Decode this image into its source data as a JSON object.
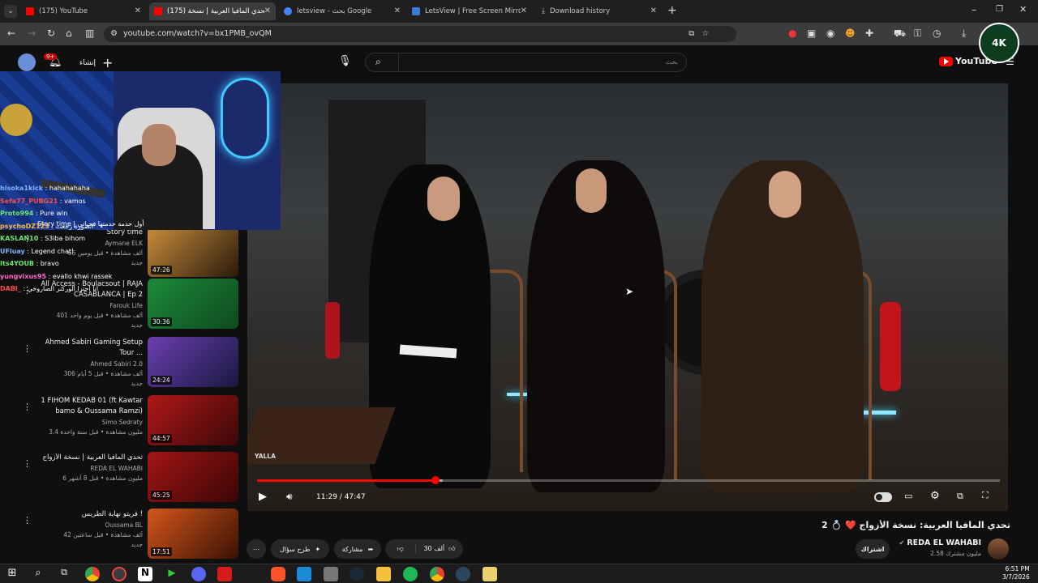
{
  "tabs": [
    {
      "title": "(175) YouTube",
      "fav_color": "#ff0000"
    },
    {
      "title": "تحدي المافيا العربية | نسخة (175)",
      "fav_color": "#ff0000"
    },
    {
      "title": "letsview - بحث Google",
      "fav_color": "#4285f4"
    },
    {
      "title": "LetsView | Free Screen Mirrorin",
      "fav_color": "#3a7bd5"
    },
    {
      "title": "Download history",
      "fav_color": "#9aa0a6"
    }
  ],
  "url": "youtube.com/watch?v=bx1PMB_ovQM",
  "youtube": {
    "create_label": "إنشاء",
    "notif_count": "9+",
    "search_placeholder": "بحث",
    "logo_text": "YouTube",
    "channel_badge": "4K"
  },
  "overlay_label": "Story time | أول حدمة حدمتها فحياتي",
  "chat": [
    {
      "user": "hisoka1kick",
      "msg": "hahahahaha",
      "color": "#7fb3ff"
    },
    {
      "user": "Sefa77_PUBG21",
      "msg": "vamos",
      "color": "#ff4d4d"
    },
    {
      "user": "Proto994",
      "msg": "Pure win",
      "color": "#6ee56e"
    },
    {
      "user": "psychoDZ123",
      "msg": "الصورة رجعت",
      "color": "#ffb84d"
    },
    {
      "user": "KASLAN10",
      "msg": "S3iba bihom",
      "color": "#6ee56e"
    },
    {
      "user": "UFluay",
      "msg": "Legend chat!",
      "color": "#7fb3ff"
    },
    {
      "user": "Its4YOUB",
      "msg": "bravo",
      "color": "#6ee56e"
    },
    {
      "user": "yungvixus95",
      "msg": "evallo khwi rassek",
      "color": "#ff66cc"
    },
    {
      "user": "DABI_",
      "msg": "انا احترا الوركنر الصاروخي",
      "color": "#ff4d4d"
    }
  ],
  "recommendations": [
    {
      "title": "Story time",
      "channel": "Aymane ELK",
      "meta": "66 ألف مشاهدة • قبل يومين",
      "badge": "جديد",
      "duration": "47:26",
      "colors": [
        "#c88d3a",
        "#2b1a0d"
      ]
    },
    {
      "title": "All Access - Boulacsout | RAJA",
      "title2": "CASABLANCA | Ep 2",
      "channel": "Farouk Life",
      "meta": "401 ألف مشاهدة • قبل يوم واحد",
      "badge": "جديد",
      "duration": "30:36",
      "colors": [
        "#1d8a3a",
        "#0e4a1f"
      ]
    },
    {
      "title": "Ahmed Sabiri Gaming Setup",
      "title2": "Tour ...",
      "channel": "Ahmed Sabiri 2.0",
      "meta": "306 ألف مشاهدة • قبل 5 أيام",
      "badge": "جديد",
      "duration": "24:24",
      "colors": [
        "#6a3fb0",
        "#1a1840"
      ]
    },
    {
      "title": "1 FIHOM KEDAB 01 (ft Kawtar",
      "title2": "bamo & Oussama Ramzi)",
      "channel": "Simo Sedraty",
      "meta": "3.4 مليون مشاهدة • قبل سنة واحدة",
      "badge": "",
      "duration": "44:57",
      "colors": [
        "#b01818",
        "#3a0808"
      ]
    },
    {
      "title": "تحدي المافيا العربية | نسخة الأزواج",
      "channel": "REDA EL WAHABI",
      "meta": "6 مليون مشاهدة • قبل 8 أشهر",
      "badge": "",
      "duration": "45:25",
      "colors": [
        "#a31515",
        "#3a0606"
      ]
    },
    {
      "title": "فريتو نهاية الطريس !",
      "channel": "Oussama BL",
      "meta": "42 ألف مشاهدة • قبل ساعتين",
      "badge": "جديد",
      "duration": "17:51",
      "colors": [
        "#d4561a",
        "#3a1205"
      ]
    }
  ],
  "player": {
    "watermark": "YALLA",
    "time": "11:29 / 47:47",
    "progress_fraction": 0.24,
    "loaded_fraction": 0.25
  },
  "video_title": "تحدي المافيا العربية: نسخة الأزواج ❤️ 💍 2",
  "channel": {
    "name": "REDA EL WAHABI",
    "subs": "2.58 مليون مشترك",
    "subscribe": "اشتراك"
  },
  "actions": {
    "likes": "30 ألف",
    "share": "مشاركة",
    "ask": "طرح سؤال"
  },
  "clock": {
    "time": "6:51 PM",
    "date": "3/7/2026"
  },
  "accent": "#ff0000"
}
